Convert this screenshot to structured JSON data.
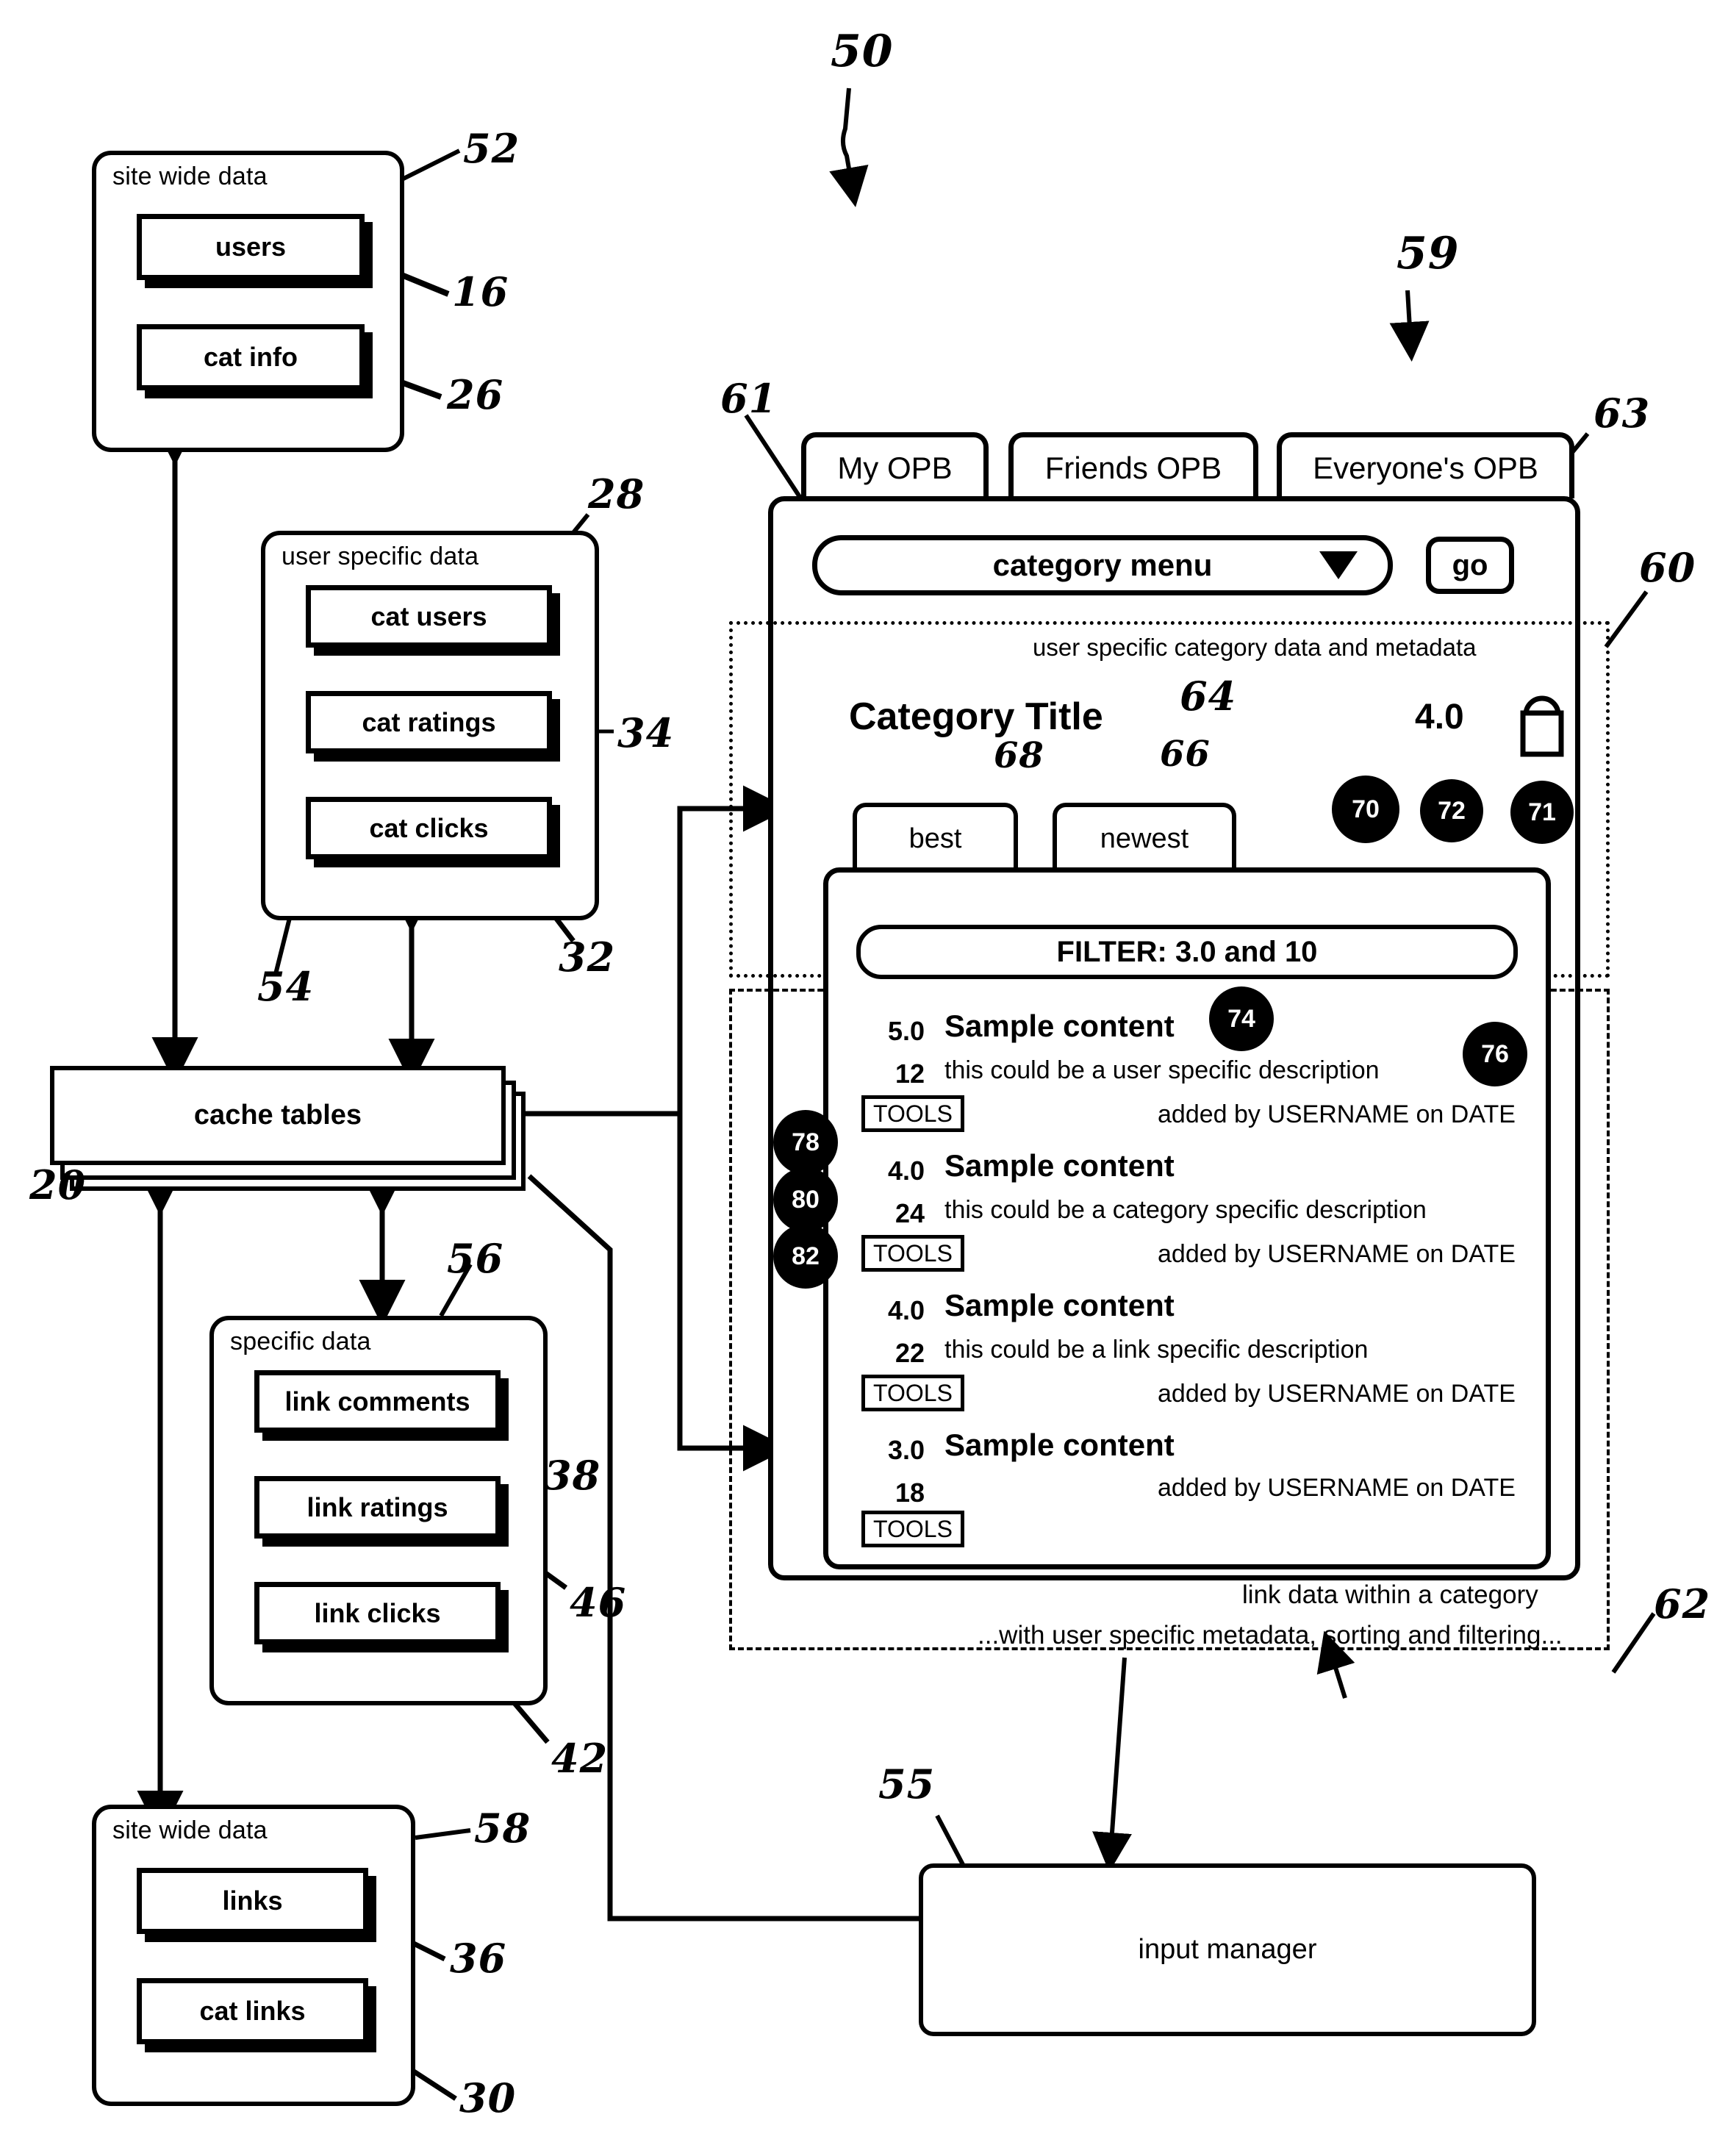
{
  "figure": {
    "number_50": "50",
    "number_59": "59",
    "number_60": "60",
    "number_61": "61",
    "number_62": "62",
    "number_63": "63",
    "number_55": "55"
  },
  "site_wide_data_top": {
    "title": "site wide data",
    "ref": "52",
    "items": [
      {
        "label": "users",
        "ref": "16"
      },
      {
        "label": "cat info",
        "ref": "26"
      }
    ]
  },
  "user_specific_data": {
    "title": "user specific data",
    "ref_group": "54",
    "ref_top": "28",
    "items": [
      {
        "label": "cat users",
        "ref": "28"
      },
      {
        "label": "cat ratings",
        "ref": "34"
      },
      {
        "label": "cat clicks",
        "ref": "32"
      }
    ]
  },
  "cache_tables": {
    "label": "cache tables",
    "ref": "20"
  },
  "specific_data": {
    "title": "specific data",
    "ref_group": "56",
    "items": [
      {
        "label": "link comments",
        "ref": "38"
      },
      {
        "label": "link ratings",
        "ref": "46"
      },
      {
        "label": "link clicks",
        "ref": "42"
      }
    ]
  },
  "site_wide_data_bottom": {
    "title": "site wide data",
    "ref": "58",
    "items": [
      {
        "label": "links",
        "ref": "36"
      },
      {
        "label": "cat links",
        "ref": "30"
      }
    ]
  },
  "input_manager": {
    "label": "input manager",
    "ref": "55"
  },
  "ui": {
    "tabs": [
      {
        "label": "My OPB"
      },
      {
        "label": "Friends OPB"
      },
      {
        "label": "Everyone's OPB"
      }
    ],
    "category_menu": {
      "label": "category menu",
      "ref": "61"
    },
    "go_button": {
      "label": "go",
      "ref": "63"
    },
    "region_top_caption": "user specific category data and metadata",
    "region_top_ref": "60",
    "category_title": {
      "label": "Category Title",
      "ref": "64"
    },
    "category_rating": {
      "value": "4.0",
      "ref": "72"
    },
    "lock_icon_ref": "71",
    "sort_tabs": [
      {
        "label": "best",
        "ref": "68"
      },
      {
        "label": "newest",
        "ref": "66"
      }
    ],
    "filter": {
      "label": "FILTER: 3.0 and 10",
      "ref": "70"
    },
    "list_items": [
      {
        "rating": "5.0",
        "count": "12",
        "title": "Sample content",
        "description": "this could be a user specific description",
        "added": "added by USERNAME on DATE",
        "tools": "TOOLS",
        "title_ref": "74",
        "description_ref": "76"
      },
      {
        "rating": "4.0",
        "count": "24",
        "title": "Sample content",
        "description": "this could be a category specific description",
        "added": "added by USERNAME on DATE",
        "tools": "TOOLS"
      },
      {
        "rating": "4.0",
        "count": "22",
        "title": "Sample content",
        "description": "this could be a link specific description",
        "added": "added by USERNAME on DATE",
        "tools": "TOOLS"
      },
      {
        "rating": "3.0",
        "count": "18",
        "title": "Sample content",
        "description": "",
        "added": "added by USERNAME on DATE",
        "tools": "TOOLS"
      }
    ],
    "row_refs": {
      "rating_ref": "78",
      "count_ref": "80",
      "tools_ref": "82"
    },
    "region_bottom_caption_line1": "link data within a category",
    "region_bottom_caption_line2": "...with user specific metadata, sorting and filtering...",
    "region_bottom_ref": "62"
  }
}
